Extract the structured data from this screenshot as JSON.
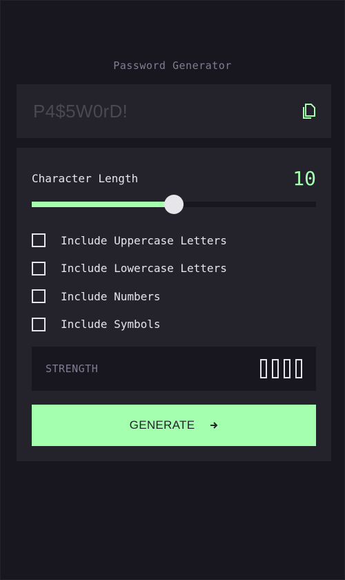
{
  "app": {
    "title": "Password Generator"
  },
  "password": {
    "value": "P4$5W0rD!",
    "copy_icon": "copy-icon"
  },
  "length": {
    "label": "Character Length",
    "value": "10",
    "slider_fraction": 0.5
  },
  "options": [
    {
      "label": "Include Uppercase Letters",
      "checked": false
    },
    {
      "label": "Include Lowercase Letters",
      "checked": false
    },
    {
      "label": "Include Numbers",
      "checked": false
    },
    {
      "label": "Include Symbols",
      "checked": false
    }
  ],
  "strength": {
    "label": "STRENGTH",
    "filled_bars": 0,
    "total_bars": 4
  },
  "generate": {
    "label": "GENERATE",
    "icon": "arrow-right-icon"
  },
  "colors": {
    "accent": "#a4ffaf",
    "background": "#18171f",
    "panel": "#24232c",
    "muted": "#817d92",
    "text": "#e6e5ea"
  }
}
